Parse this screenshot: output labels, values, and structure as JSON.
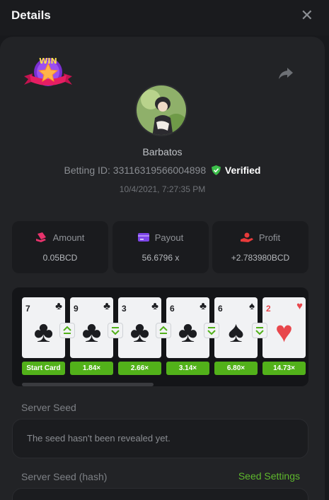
{
  "header": {
    "title": "Details",
    "close_icon": "close-icon"
  },
  "player": {
    "name": "Barbatos",
    "betting_id_label": "Betting ID:",
    "betting_id": "33116319566004898",
    "verified": "Verified",
    "date": "10/4/2021, 7:27:35 PM"
  },
  "badge": {
    "text": "WIN"
  },
  "stats": {
    "amount": {
      "label": "Amount",
      "value": "0.05BCD"
    },
    "payout": {
      "label": "Payout",
      "value": "56.6796 x"
    },
    "profit": {
      "label": "Profit",
      "value": "+2.783980BCD"
    }
  },
  "cards": [
    {
      "rank": "7",
      "suit": "♣",
      "color": "black",
      "pill": "Start Card"
    },
    {
      "rank": "9",
      "suit": "♣",
      "color": "black",
      "pill": "1.84×"
    },
    {
      "rank": "3",
      "suit": "♣",
      "color": "black",
      "pill": "2.66×"
    },
    {
      "rank": "6",
      "suit": "♣",
      "color": "black",
      "pill": "3.14×"
    },
    {
      "rank": "6",
      "suit": "♠",
      "color": "black",
      "pill": "6.80×"
    },
    {
      "rank": "2",
      "suit": "♥",
      "color": "red",
      "pill": "14.73×"
    }
  ],
  "guesses": [
    "higher",
    "lower",
    "higher",
    "lower",
    "lower"
  ],
  "server_seed": {
    "label": "Server Seed",
    "text": "The seed hasn't been revealed yet."
  },
  "server_seed_hash": {
    "label": "Server Seed (hash)",
    "link": "Seed Settings"
  },
  "colors": {
    "accent_green": "#52b11a",
    "panel": "#222326",
    "background": "#18191c"
  }
}
